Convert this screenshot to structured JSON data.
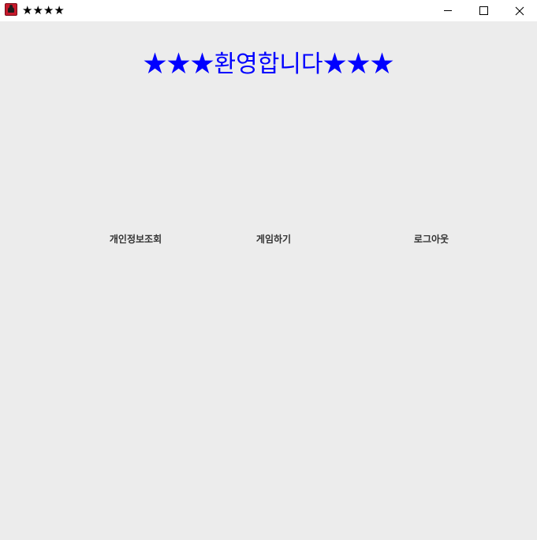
{
  "window": {
    "title": "★★★★",
    "icon": "red-app-icon"
  },
  "main": {
    "heading": "★★★환영합니다★★★",
    "heading_color": "#0000ff",
    "buttons": [
      {
        "label": "개인정보조회"
      },
      {
        "label": "게임하기"
      },
      {
        "label": "로그아웃"
      }
    ]
  }
}
